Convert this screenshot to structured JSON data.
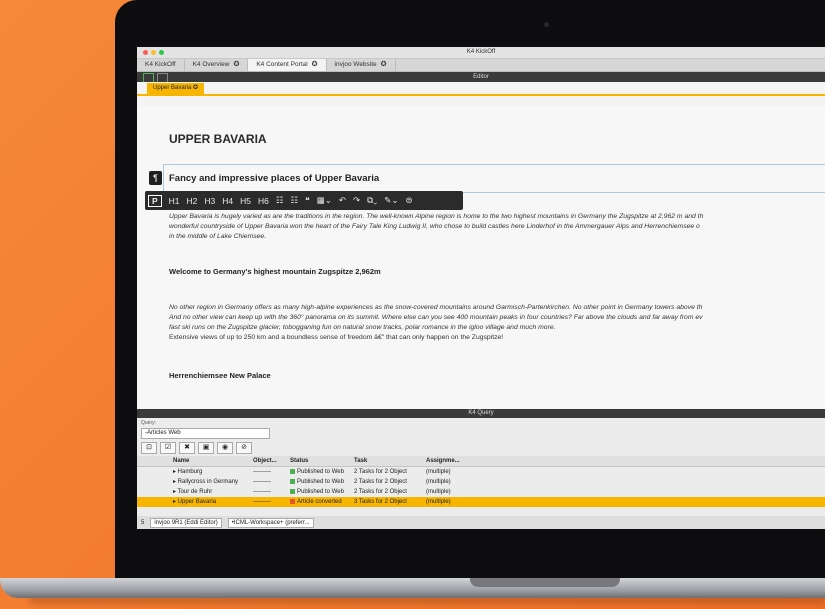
{
  "window": {
    "title": "K4 KickOff"
  },
  "tabs": [
    {
      "label": "K4 KickOff",
      "close": ""
    },
    {
      "label": "K4 Overview",
      "close": "✪"
    },
    {
      "label": "K4 Content Portal",
      "close": "✪"
    },
    {
      "label": "invjoo Website",
      "close": "✪"
    }
  ],
  "editor": {
    "header": "Editor",
    "subtab": "Upper Bavaria ✪",
    "h1": "UPPER BAVARIA",
    "h2": "Fancy and impressive places of Upper Bavaria",
    "para_mark": "¶",
    "toolbar": {
      "p": "P",
      "items": [
        "H1",
        "H2",
        "H3",
        "H4",
        "H5",
        "H6",
        "☷",
        "☷",
        "❝",
        "▦⌄",
        "↶",
        "↷",
        "⧉⌄",
        "✎⌄",
        "⊜"
      ]
    },
    "para1": [
      "Upper Bavaria is hugely varied as are the traditions in the region. The well-known Alpine region is home to the two highest mountains in Germany the Zugspitze at 2,962 m and th",
      "wonderful countryside of Upper Bavaria won the heart of the Fairy Tale King Ludwig II, who chose to build castles here Linderhof in the Ammergauer Alps and Herrenchiemsee o",
      "in the middle of Lake Chiemsee."
    ],
    "h3a": "Welcome to Germany's highest mountain Zugspitze 2,962m",
    "para2": [
      "No other region in Germany offers as many high-alpine experiences as the snow-covered mountains around Garmisch-Partenkirchen. No other point in Germany towers above th",
      "And no other view can keep up with the 360° panorama on its summit. Where else can you see 400 mountain peaks in four countries? Far above the clouds and far away from ev",
      "fast ski runs on the Zugspitze glacier, tobogganing fun on natural snow tracks, polar romance in the igloo village and much more."
    ],
    "para2_plain": "Extensive views of up to 250 km and a boundless sense of freedom â€\" that can only happen on the Zugspitze!",
    "h3b": "Herrenchiemsee New Palace"
  },
  "query": {
    "header": "K4 Query",
    "label": "Query:",
    "selected": "-Articles Web",
    "tools": [
      "⊡",
      "☑",
      "✖",
      "▣",
      "◉",
      "⊘"
    ],
    "columns": [
      "Name",
      "Object...",
      "Status",
      "Task",
      "Assignme..."
    ],
    "rows": [
      {
        "name": "▸ Hamburg",
        "object": "---------",
        "status": "Published to Web",
        "task": "2 Tasks for 2 Object",
        "assign": "(multiple)",
        "statusColor": "#4caf50"
      },
      {
        "name": "▸ Rallycross in Germany",
        "object": "---------",
        "status": "Published to Web",
        "task": "2 Tasks for 2 Object",
        "assign": "(multiple)",
        "statusColor": "#4caf50"
      },
      {
        "name": "▸ Tour de Ruhr",
        "object": "---------",
        "status": "Published to Web",
        "task": "2 Tasks for 2 Object",
        "assign": "(multiple)",
        "statusColor": "#4caf50"
      },
      {
        "name": "▸ Upper Bavaria",
        "object": "---------",
        "status": "Article converted",
        "task": "3 Tasks for 2 Object",
        "assign": "(multiple)",
        "statusColor": "#e8552a"
      }
    ],
    "footer": {
      "count": "5",
      "editor": "invjoo 9R1 (Eddi Editor)",
      "workspace": "•ICML-Workspace+ (preferr..."
    }
  },
  "colors": {
    "accent": "#f7b500",
    "background": "#f27a2e"
  }
}
